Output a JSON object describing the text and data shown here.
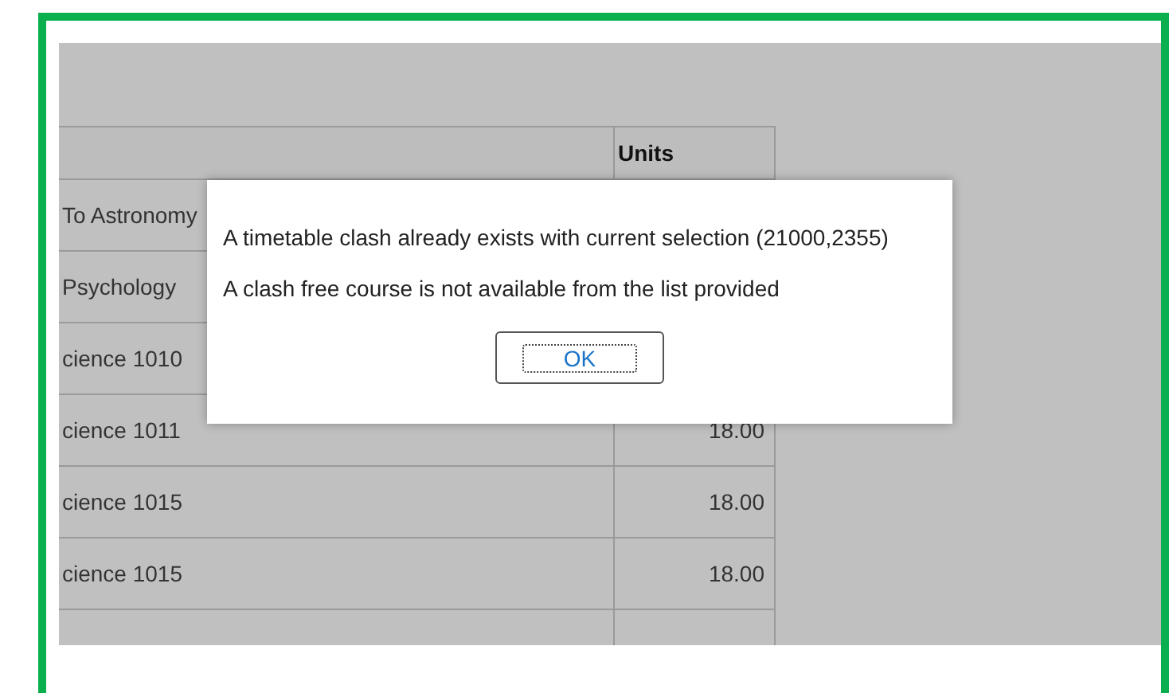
{
  "table": {
    "columns": [
      {
        "label": "Units"
      }
    ],
    "rows": [
      {
        "course": "To Astronomy"
      },
      {
        "course": "Psychology"
      },
      {
        "course": "cience 1010"
      },
      {
        "course": "cience 1011",
        "units": "18.00"
      },
      {
        "course": "cience 1015",
        "units": "18.00"
      },
      {
        "course": "cience 1015",
        "units": "18.00"
      }
    ]
  },
  "dialog": {
    "messages": [
      "A timetable clash already exists with current selection (21000,2355)",
      "A clash free course is not available from the list provided"
    ],
    "button": "OK"
  }
}
